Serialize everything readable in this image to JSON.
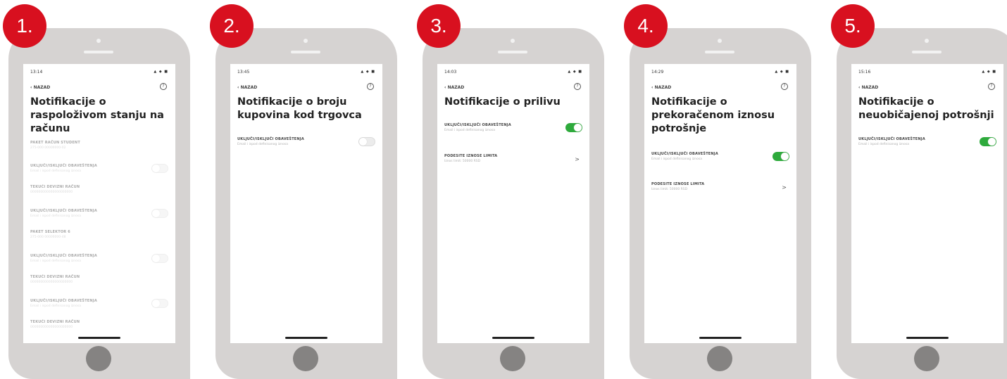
{
  "colors": {
    "badge": "#d8101f",
    "toggle_on": "#2eaa3c",
    "phone_body": "#d6d3d2",
    "home_button": "#858382"
  },
  "icons": {
    "back": "chevron-left-icon",
    "help": "help-circle-icon",
    "row_chevron": "chevron-right-icon"
  },
  "common": {
    "back_label": "NAZAD",
    "help_glyph": "?",
    "status_icons": "▲ ◆ ■"
  },
  "screens": [
    {
      "number": "1.",
      "time": "13:14",
      "title_lines": [
        "Notifikacije o",
        "raspoloživom stanju na",
        "računu"
      ],
      "rows": [
        {
          "label": "PAKET RAČUN STUDENT",
          "sub": "275-000 00000000-02"
        },
        {
          "label": "UKLJUČI/ISKLJUČI OBAVEŠTENJA",
          "sub": "Email i ispod definisanog iznosa",
          "toggle": "off"
        },
        {
          "label": "TEKUĆI DEVIZNI RAČUN",
          "sub": "000000000000000000000"
        },
        {
          "label": "UKLJUČI/ISKLJUČI OBAVEŠTENJA",
          "sub": "Email i ispod definisanog iznosa",
          "toggle": "off"
        },
        {
          "label": "PAKET SELEKTOR 6",
          "sub": "275-000 00000000-48"
        },
        {
          "label": "UKLJUČI/ISKLJUČI OBAVEŠTENJA",
          "sub": "Email i ispod definisanog iznosa",
          "toggle": "off"
        },
        {
          "label": "TEKUĆI DEVIZNI RAČUN",
          "sub": "000000000000000000000"
        },
        {
          "label": "UKLJUČI/ISKLJUČI OBAVEŠTENJA",
          "sub": "Email i ispod definisanog iznosa",
          "toggle": "off"
        },
        {
          "label": "TEKUĆI DEVIZNI RAČUN",
          "sub": "000000000000000000000"
        }
      ]
    },
    {
      "number": "2.",
      "time": "13:45",
      "title_lines": [
        "Notifikacije o broju",
        "kupovina kod trgovca"
      ],
      "rows": [
        {
          "label": "UKLJUČI/ISKLJUČI OBAVEŠTENJA",
          "sub": "Email i ispod definisanog iznosa",
          "toggle": "off"
        }
      ]
    },
    {
      "number": "3.",
      "time": "14:03",
      "title_lines": [
        "Notifikacije o prilivu"
      ],
      "rows": [
        {
          "label": "UKLJUČI/ISKLJUČI OBAVEŠTENJA",
          "sub": "Email i ispod definisanog iznosa",
          "toggle": "on"
        },
        {
          "label": "PODESITE IZNOSE LIMITA",
          "sub": "Iznos limit: 50000 RSD",
          "chevron": ">"
        }
      ]
    },
    {
      "number": "4.",
      "time": "14:29",
      "title_lines": [
        "Notifikacije o",
        "prekoračenom iznosu",
        "potrošnje"
      ],
      "rows": [
        {
          "label": "UKLJUČI/ISKLJUČI OBAVEŠTENJA",
          "sub": "Email i ispod definisanog iznosa",
          "toggle": "on"
        },
        {
          "label": "PODESITE IZNOSE LIMITA",
          "sub": "Iznos limit: 50000 RSD",
          "chevron": ">"
        }
      ]
    },
    {
      "number": "5.",
      "time": "15:16",
      "title_lines": [
        "Notifikacije o",
        "neuobičajenoj potrošnji"
      ],
      "rows": [
        {
          "label": "UKLJUČI/ISKLJUČI OBAVEŠTENJA",
          "sub": "Email i ispod definisanog iznosa",
          "toggle": "on"
        }
      ]
    }
  ]
}
